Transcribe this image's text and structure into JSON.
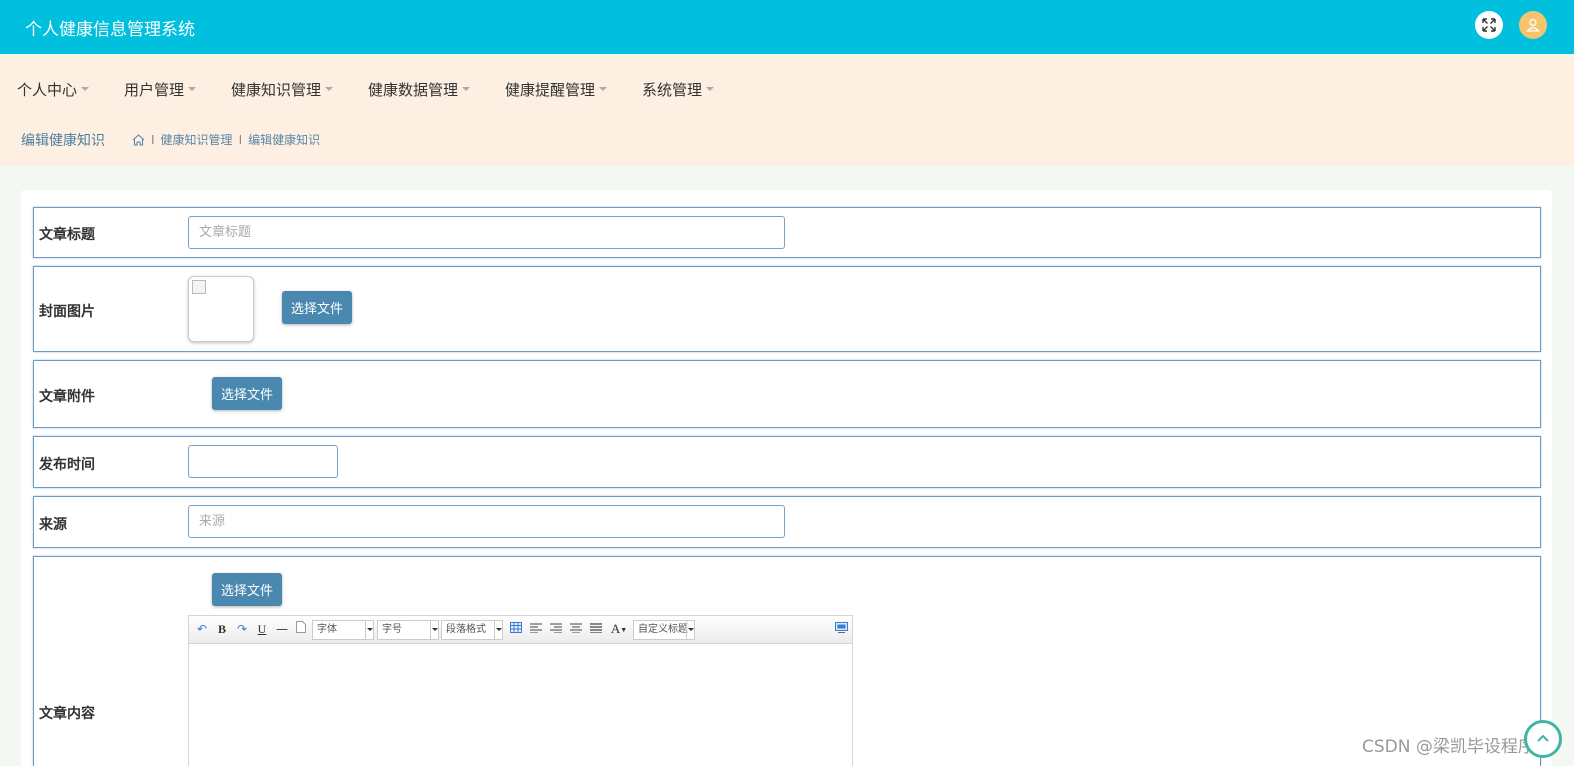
{
  "app": {
    "title": "个人健康信息管理系统"
  },
  "header": {
    "fullscreen_icon": "expand-icon",
    "avatar_icon": "user-icon",
    "accent_color": "#00c0de"
  },
  "nav": {
    "items": [
      {
        "label": "个人中心"
      },
      {
        "label": "用户管理"
      },
      {
        "label": "健康知识管理"
      },
      {
        "label": "健康数据管理"
      },
      {
        "label": "健康提醒管理"
      },
      {
        "label": "系统管理"
      }
    ]
  },
  "page": {
    "title": "编辑健康知识",
    "breadcrumb": {
      "home_icon": "home-icon",
      "section": "健康知识管理",
      "current": "编辑健康知识",
      "separator": "I"
    }
  },
  "form": {
    "title": {
      "label": "文章标题",
      "placeholder": "文章标题",
      "value": ""
    },
    "cover": {
      "label": "封面图片",
      "button": "选择文件"
    },
    "attachment": {
      "label": "文章附件",
      "button": "选择文件"
    },
    "publish_time": {
      "label": "发布时间",
      "value": ""
    },
    "source": {
      "label": "来源",
      "placeholder": "来源",
      "value": ""
    },
    "content": {
      "label": "文章内容",
      "button": "选择文件",
      "toolbar": {
        "font": "字体",
        "size": "字号",
        "paragraph": "段落格式",
        "custom_title": "自定义标题",
        "bold": "B",
        "underline": "U",
        "text_color": "A"
      }
    }
  },
  "watermark": "CSDN @梁凯毕设程序"
}
